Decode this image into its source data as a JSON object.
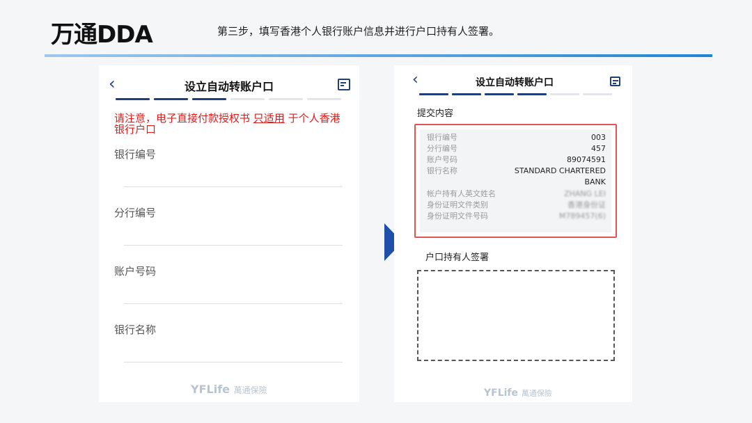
{
  "slide": {
    "title": "万通DDA",
    "subtitle": "第三步，填写香港个人银行账户信息并进行户口持有人签署。"
  },
  "left_screen": {
    "nav_title": "设立自动转账户口",
    "notice_before": "请注意，电子直接付款授权书 ",
    "notice_link": "只适用",
    "notice_after": " 于个人香港银行户口",
    "fields": [
      "银行编号",
      "分行编号",
      "账户号码",
      "银行名称"
    ],
    "watermark_latin": "YFLife",
    "watermark_cn": "萬通保險"
  },
  "right_screen": {
    "nav_title": "设立自动转账户口",
    "section_title": "提交内容",
    "summary": [
      {
        "label": "银行编号",
        "value": "003"
      },
      {
        "label": "分行编号",
        "value": "457"
      },
      {
        "label": "账户号码",
        "value": "89074591"
      },
      {
        "label": "银行名称",
        "value": "STANDARD CHARTERED"
      },
      {
        "label": "",
        "value": "BANK"
      },
      {
        "label": "帐户持有人英文姓名",
        "value": "ZHANG LEI"
      },
      {
        "label": "身份证明文件类别",
        "value": "香港身份证"
      },
      {
        "label": "身份证明文件号码",
        "value": "M789457(6)"
      }
    ],
    "signature_label": "户口持有人签署",
    "watermark_latin": "YFLife",
    "watermark_cn": "萬通保險"
  },
  "colors": {
    "nav_blue": "#1f3f7a",
    "notice_red": "#e01b1b",
    "highlight_red": "#e05454",
    "arrow_blue": "#1f4fa8"
  },
  "icons": [
    "back-arrow-icon",
    "document-icon",
    "right-arrow-icon"
  ]
}
